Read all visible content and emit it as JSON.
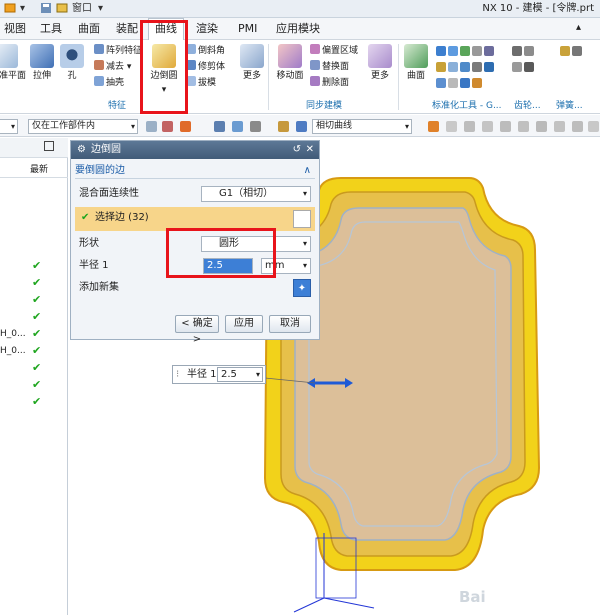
{
  "window": {
    "app_title": "NX 10 - 建模 - [令牌.prt",
    "quick_access": {
      "window_menu": "窗口"
    }
  },
  "menu": {
    "tabs": [
      "视图",
      "工具",
      "曲面",
      "装配",
      "曲线",
      "渲染",
      "PMI",
      "应用模块"
    ],
    "active_tab": "曲线"
  },
  "ribbon": {
    "big_buttons": {
      "datum_plane": "基准平面",
      "extrude": "拉伸",
      "hole": "孔",
      "edge_blend": "边倒圆",
      "more_feature": "更多",
      "move_face": "移动面",
      "more_sync": "更多",
      "surface": "曲面"
    },
    "small_buttons": {
      "pattern_feature": "阵列特征",
      "subtract": "减去",
      "shell": "抽壳",
      "chamfer": "倒斜角",
      "trim_body": "修剪体",
      "draft": "拔模",
      "offset_region": "偏置区域",
      "replace_face": "替换面",
      "delete_face": "删除面"
    },
    "group_labels": {
      "feature": "特征",
      "sync_modeling": "同步建模",
      "standard_lib": "标准化工具 - G...",
      "gear": "齿轮...",
      "spring": "弹簧..."
    }
  },
  "filter_bar": {
    "scope": "仅在工作部件内",
    "curve_rule": "相切曲线"
  },
  "navigator": {
    "column_latest": "最新",
    "rows": [
      {
        "text": "",
        "check": "✔"
      },
      {
        "text": "",
        "check": "✔"
      },
      {
        "text": "",
        "check": "✔"
      },
      {
        "text": "",
        "check": "✔"
      },
      {
        "text": "H_0...",
        "check": "✔"
      },
      {
        "text": "H_0...",
        "check": "✔"
      },
      {
        "text": "",
        "check": "✔"
      },
      {
        "text": "",
        "check": "✔"
      },
      {
        "text": "",
        "check": "✔"
      }
    ]
  },
  "dialog": {
    "title": "边倒圆",
    "section_title": "要倒圆的边",
    "blend_continuity_label": "混合面连续性",
    "blend_continuity_value": "G1（相切）",
    "select_edge_label": "选择边 (32)",
    "shape_label": "形状",
    "shape_value": "圆形",
    "radius_label": "半径 1",
    "radius_value": "2.5",
    "radius_unit": "mm",
    "add_new_set_label": "添加新集",
    "ok_button": "< 确定 >",
    "apply_button": "应用",
    "cancel_button": "取消"
  },
  "floating_input": {
    "label": "半径 1",
    "value": "2.5"
  },
  "colors": {
    "accent_highlight": "#f7d58a",
    "annotation_red": "#e8141b",
    "model_yellow": "#f2d21a",
    "model_face": "#dcbf99",
    "check_green": "#1ea51e"
  },
  "watermark": "Bai"
}
